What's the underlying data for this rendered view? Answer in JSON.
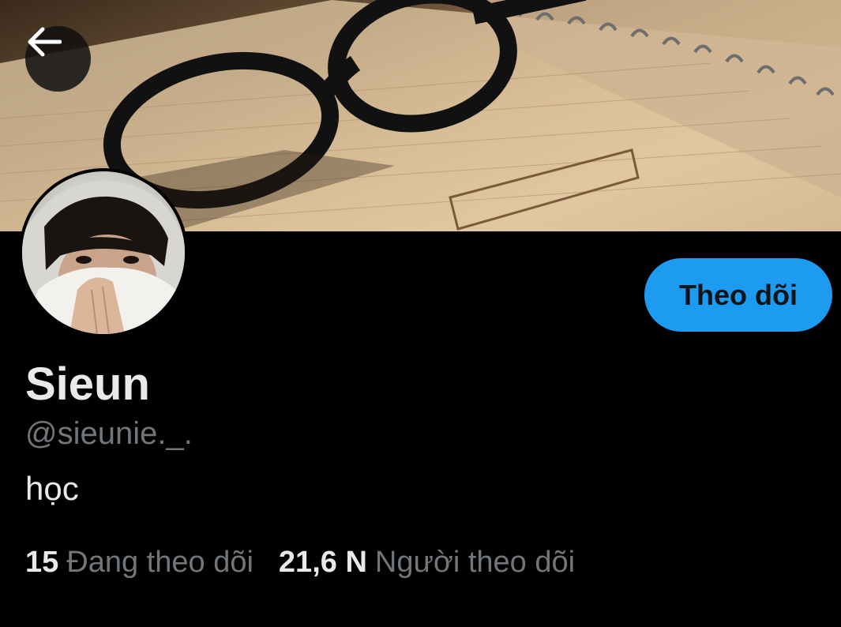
{
  "header": {
    "back_icon": "arrow-left-icon",
    "banner_image": "notebook-with-glasses-photo"
  },
  "profile": {
    "display_name": "Sieun",
    "username": "@sieunie._.",
    "bio": "học",
    "follow_label": "Theo dõi",
    "avatar": "hooded-person-photo"
  },
  "stats": {
    "following_count": "15",
    "following_label": "Đang theo dõi",
    "followers_count": "21,6 N",
    "followers_label": "Người theo dõi"
  },
  "colors": {
    "background": "#000000",
    "accent": "#1d9bf0",
    "text_primary": "#e7e9ea",
    "text_secondary": "#71767b"
  }
}
